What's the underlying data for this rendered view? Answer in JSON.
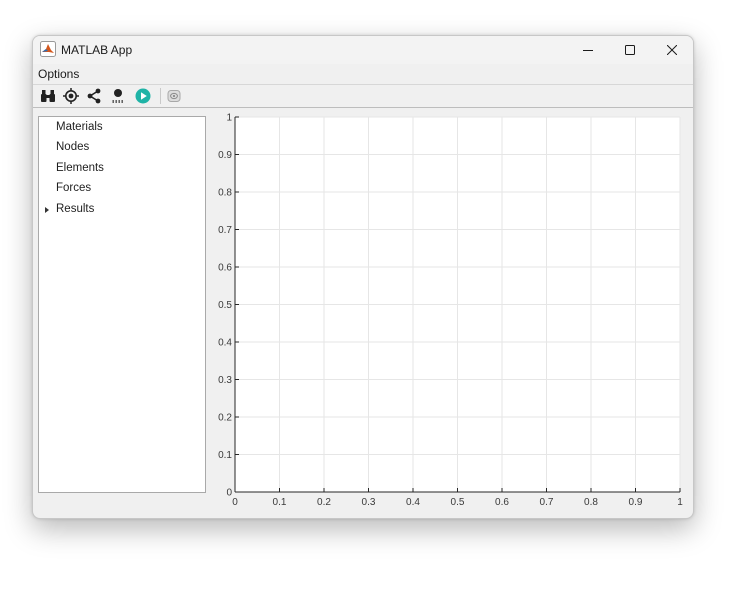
{
  "window": {
    "title": "MATLAB App",
    "controls": {
      "minimize": "minimize-icon",
      "maximize": "maximize-icon",
      "close": "close-icon"
    }
  },
  "menu": {
    "items": [
      {
        "label": "Options"
      }
    ]
  },
  "toolbar": {
    "tools": [
      {
        "name": "binoculars-icon"
      },
      {
        "name": "target-icon"
      },
      {
        "name": "share-nodes-icon"
      },
      {
        "name": "node-label-icon"
      },
      {
        "name": "run-play-icon",
        "color": "#1fb3a6"
      },
      {
        "name": "3d-view-icon"
      }
    ]
  },
  "tree": {
    "items": [
      {
        "label": "Materials",
        "expandable": false
      },
      {
        "label": "Nodes",
        "expandable": false
      },
      {
        "label": "Elements",
        "expandable": false
      },
      {
        "label": "Forces",
        "expandable": false
      },
      {
        "label": "Results",
        "expandable": true
      }
    ]
  },
  "axes": {
    "x_ticks": [
      "0",
      "0.1",
      "0.2",
      "0.3",
      "0.4",
      "0.5",
      "0.6",
      "0.7",
      "0.8",
      "0.9",
      "1"
    ],
    "y_ticks": [
      "0",
      "0.1",
      "0.2",
      "0.3",
      "0.4",
      "0.5",
      "0.6",
      "0.7",
      "0.8",
      "0.9",
      "1"
    ],
    "xlim": [
      0,
      1
    ],
    "ylim": [
      0,
      1
    ],
    "grid": true,
    "background": "#ffffff",
    "grid_color": "#e6e6e6"
  }
}
